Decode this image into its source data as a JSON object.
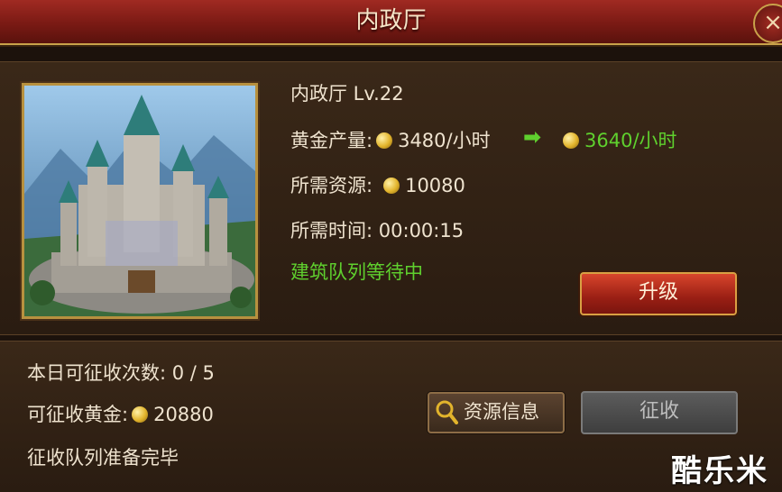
{
  "window": {
    "title": "内政厅",
    "close_label": "×"
  },
  "building": {
    "name_level": "内政厅 Lv.22",
    "gold_output_label": "黄金产量:",
    "gold_output_current": "3480/小时",
    "gold_output_next": "3640/小时",
    "required_resources_label": "所需资源:",
    "required_resources_value": "10080",
    "required_time_label": "所需时间:",
    "required_time_value": "00:00:15",
    "queue_status": "建筑队列等待中",
    "upgrade_label": "升级"
  },
  "collect": {
    "daily_count_label": "本日可征收次数:",
    "daily_count_value": "0 / 5",
    "collectible_gold_label": "可征收黄金:",
    "collectible_gold_value": "20880",
    "queue_status": "征收队列准备完毕",
    "resource_info_label": "资源信息",
    "collect_label": "征收"
  },
  "watermark": "酷乐米",
  "icons": [
    "close-icon",
    "gold-coin-icon",
    "right-arrow-icon",
    "magnifier-icon"
  ],
  "colors": {
    "title_bar": "#8a1f17",
    "highlight_green": "#5fd02e",
    "gold_border": "#c9a24a"
  }
}
